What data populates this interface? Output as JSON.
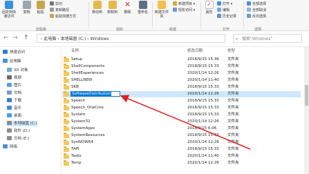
{
  "ribbon": {
    "pin_label": "固定到快速访问",
    "copy_label": "复制",
    "paste_label": "粘贴",
    "cut_label": "剪切",
    "copy_path_label": "复制路径",
    "paste_shortcut_label": "粘贴快捷方式",
    "clipboard_group": "剪贴板",
    "move_to_label": "移动到",
    "copy_to_label": "复制到",
    "delete_label": "删除",
    "rename_label": "重命名",
    "organize_group": "组织",
    "new_folder_label": "新建文件夹",
    "new_item_label": "新建项目 ▾",
    "easy_access_label": "轻松访问 ▾",
    "new_group": "新建",
    "properties_label": "属性",
    "open_label": "打开 ▾",
    "edit_label": "编辑",
    "history_label": "历史记录",
    "open_group": "打开",
    "select_all_label": "全部选择",
    "select_none_label": "全部取消",
    "invert_label": "反向选择",
    "select_group": "选择"
  },
  "nav": {
    "back": "←",
    "forward": "→",
    "up": "↑",
    "breadcrumb": "›  此电脑  ›  本地磁盘 (C:)  ›  Windows",
    "search_placeholder": "搜索\"Windows\""
  },
  "sidebar": {
    "items": [
      {
        "label": "快速访问",
        "icon": "star-icon",
        "color": "#2b7cd3"
      },
      {
        "label": "此电脑",
        "icon": "pc-icon",
        "color": "#4a90d9"
      },
      {
        "label": "3D 对象",
        "icon": "cube-icon",
        "color": "#6fa8dc"
      },
      {
        "label": "视频",
        "icon": "video-icon",
        "color": "#6a6a6a"
      },
      {
        "label": "图片",
        "icon": "picture-icon",
        "color": "#5aa0e0"
      },
      {
        "label": "文档",
        "icon": "document-icon",
        "color": "#7a9cc6"
      },
      {
        "label": "下载",
        "icon": "download-icon",
        "color": "#2f7fd8"
      },
      {
        "label": "音乐",
        "icon": "music-icon",
        "color": "#3b8de0"
      },
      {
        "label": "桌面",
        "icon": "desktop-icon",
        "color": "#4aa0e8"
      },
      {
        "label": "本地磁盘 (C:)",
        "icon": "drive-icon",
        "color": "#8a8a8a"
      },
      {
        "label": "软件 (D:)",
        "icon": "drive-icon",
        "color": "#8a8a8a"
      },
      {
        "label": "文档 (E:)",
        "icon": "drive-icon",
        "color": "#8a8a8a"
      },
      {
        "label": "网络",
        "icon": "network-icon",
        "color": "#4a90d9"
      }
    ]
  },
  "columns": {
    "name": "名称",
    "date": "修改日期",
    "type": "类型"
  },
  "files": [
    {
      "name": "Setup",
      "date": "2018/9/15 15:36",
      "type": "文件夹"
    },
    {
      "name": "ShellComponents",
      "date": "2018/9/15 15:33",
      "type": "文件夹"
    },
    {
      "name": "ShellExperiences",
      "date": "2020/1/14 12:26",
      "type": "文件夹"
    },
    {
      "name": "SHELLNEW",
      "date": "2020/1/14 11:40",
      "type": "文件夹"
    },
    {
      "name": "SKB",
      "date": "2018/9/15 15:33",
      "type": "文件夹"
    },
    {
      "name": "SoftwareDistribution",
      "date": "2020/1/14 12:26",
      "type": "文件夹"
    },
    {
      "name": "Speech",
      "date": "2018/9/15 15:33",
      "type": "文件夹"
    },
    {
      "name": "Speech_OneCore",
      "date": "2018/9/15 15:33",
      "type": "文件夹"
    },
    {
      "name": "System",
      "date": "2018/9/15 15:33",
      "type": "文件夹"
    },
    {
      "name": "System32",
      "date": "2020/1/14 12:26",
      "type": "文件夹"
    },
    {
      "name": "SystemApps",
      "date": "2018/9/15 6:06",
      "type": "文件夹"
    },
    {
      "name": "SystemResources",
      "date": "2018/9/15 15:33",
      "type": "文件夹"
    },
    {
      "name": "SysWOW64",
      "date": "2020/1/14 12:26",
      "type": "文件夹"
    },
    {
      "name": "TAPI",
      "date": "2018/9/15 15:33",
      "type": "文件夹"
    },
    {
      "name": "Tasks",
      "date": "2020/1/14 11:40",
      "type": "文件夹"
    },
    {
      "name": "Temp",
      "date": "2020/1/14 12:26",
      "type": "文件夹"
    }
  ],
  "colors": {
    "accent": "#0078d7",
    "arrow": "#e02020",
    "folder": "#f4c85a"
  }
}
